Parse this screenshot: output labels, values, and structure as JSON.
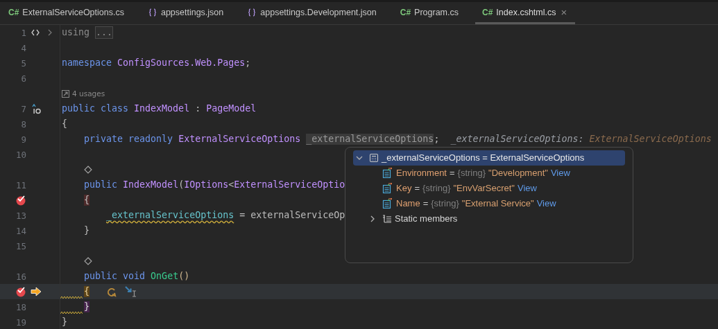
{
  "tabs": [
    {
      "kind": "csharp",
      "badge": "C#",
      "label": "ExternalServiceOptions.cs",
      "selected": false
    },
    {
      "kind": "json",
      "label": "appsettings.json",
      "selected": false
    },
    {
      "kind": "json",
      "label": "appsettings.Development.json",
      "selected": false
    },
    {
      "kind": "csharp",
      "badge": "C#",
      "label": "Program.cs",
      "selected": false
    },
    {
      "kind": "csharp",
      "badge": "C#",
      "label": "Index.cshtml.cs",
      "selected": true,
      "close": "×"
    }
  ],
  "editor": {
    "rows": [
      {
        "kind": "code",
        "number": "1",
        "gutter": [
          {
            "kind": "region"
          },
          {
            "kind": "fold-collapsed"
          }
        ],
        "current": false,
        "tokens": [
          {
            "kind": "muted",
            "text": "using "
          },
          {
            "kind": "folded",
            "text": "..."
          }
        ]
      },
      {
        "kind": "code",
        "number": "4",
        "current": false
      },
      {
        "kind": "code",
        "number": "5",
        "current": false,
        "tokens": [
          {
            "kind": "keyword",
            "text": "namespace "
          },
          {
            "kind": "type",
            "text": "ConfigSources.Web.Pages"
          },
          {
            "kind": "plain",
            "text": ";"
          }
        ]
      },
      {
        "kind": "code",
        "number": "6",
        "current": false
      },
      {
        "kind": "usages",
        "text": "4 usages",
        "current": false
      },
      {
        "kind": "code",
        "number": "7",
        "gutter": [
          {
            "kind": "implements"
          }
        ],
        "current": false,
        "tokens": [
          {
            "kind": "keyword",
            "text": "public class "
          },
          {
            "kind": "type",
            "text": "IndexModel"
          },
          {
            "kind": "plain",
            "text": " : "
          },
          {
            "kind": "type",
            "text": "PageModel"
          }
        ]
      },
      {
        "kind": "code",
        "number": "8",
        "current": false,
        "tokens": [
          {
            "kind": "plain",
            "text": "{"
          }
        ]
      },
      {
        "kind": "code",
        "number": "9",
        "current": false,
        "tokens": [
          {
            "kind": "keyword",
            "text": "    private readonly "
          },
          {
            "kind": "type",
            "text": "ExternalServiceOptions "
          },
          {
            "kind": "field-selected",
            "text": "_externalServiceOptions"
          },
          {
            "kind": "plain",
            "text": ";  "
          },
          {
            "kind": "hint-name",
            "text": "_externalServiceOptions: "
          },
          {
            "kind": "hint-type",
            "text": "ExternalServiceOptions"
          }
        ]
      },
      {
        "kind": "code",
        "number": "10",
        "current": false
      },
      {
        "kind": "member-marker",
        "current": false
      },
      {
        "kind": "code",
        "number": "11",
        "current": false,
        "tokens": [
          {
            "kind": "keyword",
            "text": "    public "
          },
          {
            "kind": "type",
            "text": "IndexModel"
          },
          {
            "kind": "plain",
            "text": "("
          },
          {
            "kind": "type",
            "text": "IOptions"
          },
          {
            "kind": "plain",
            "text": "<"
          },
          {
            "kind": "type",
            "text": "ExternalServiceOptio"
          }
        ]
      },
      {
        "kind": "code",
        "gutter": [
          {
            "kind": "breakpoint"
          }
        ],
        "current": false,
        "tokens": [
          {
            "kind": "brace-breakpoint",
            "text": "    {"
          }
        ]
      },
      {
        "kind": "code",
        "number": "13",
        "current": false,
        "tokens": [
          {
            "kind": "field-warning",
            "text": "        _externalServiceOptions"
          },
          {
            "kind": "plain",
            "text": " = externalServiceOp"
          }
        ]
      },
      {
        "kind": "code",
        "number": "14",
        "current": false,
        "tokens": [
          {
            "kind": "plain",
            "text": "    }"
          }
        ]
      },
      {
        "kind": "code",
        "number": "15",
        "current": false
      },
      {
        "kind": "member-marker",
        "current": false
      },
      {
        "kind": "code",
        "number": "16",
        "current": false,
        "tokens": [
          {
            "kind": "keyword",
            "text": "    public void "
          },
          {
            "kind": "method",
            "text": "OnGet"
          },
          {
            "kind": "paren",
            "text": "()"
          }
        ]
      },
      {
        "kind": "code",
        "gutter": [
          {
            "kind": "breakpoint"
          },
          {
            "kind": "execution-arrow"
          }
        ],
        "current": true,
        "squiggle": true,
        "tokens": [
          {
            "kind": "brace-current",
            "text": "    {"
          }
        ],
        "actions": [
          {
            "kind": "step-over"
          },
          {
            "kind": "run-to-cursor"
          }
        ]
      },
      {
        "kind": "code",
        "number": "18",
        "current": false,
        "squiggle": true,
        "tokens": [
          {
            "kind": "brace-match",
            "text": "    }"
          }
        ]
      },
      {
        "kind": "code",
        "number": "19",
        "current": false,
        "tokens": [
          {
            "kind": "plain",
            "text": "}"
          }
        ]
      }
    ]
  },
  "debug_popup": {
    "root": {
      "name": "_externalServiceOptions",
      "equals": "=",
      "value": "ExternalServiceOptions",
      "expanded": true,
      "selected": true,
      "children": [
        {
          "kind": "property",
          "name": "Environment",
          "equals": "=",
          "type": "{string}",
          "value": "\"Development\"",
          "link": "View"
        },
        {
          "kind": "property",
          "name": "Key",
          "equals": "=",
          "type": "{string}",
          "value": "\"EnvVarSecret\"",
          "link": "View"
        },
        {
          "kind": "property",
          "name": "Name",
          "equals": "=",
          "type": "{string}",
          "value": "\"External Service\"",
          "link": "View"
        },
        {
          "kind": "group",
          "name": "Static members",
          "expanded": false
        }
      ]
    }
  }
}
